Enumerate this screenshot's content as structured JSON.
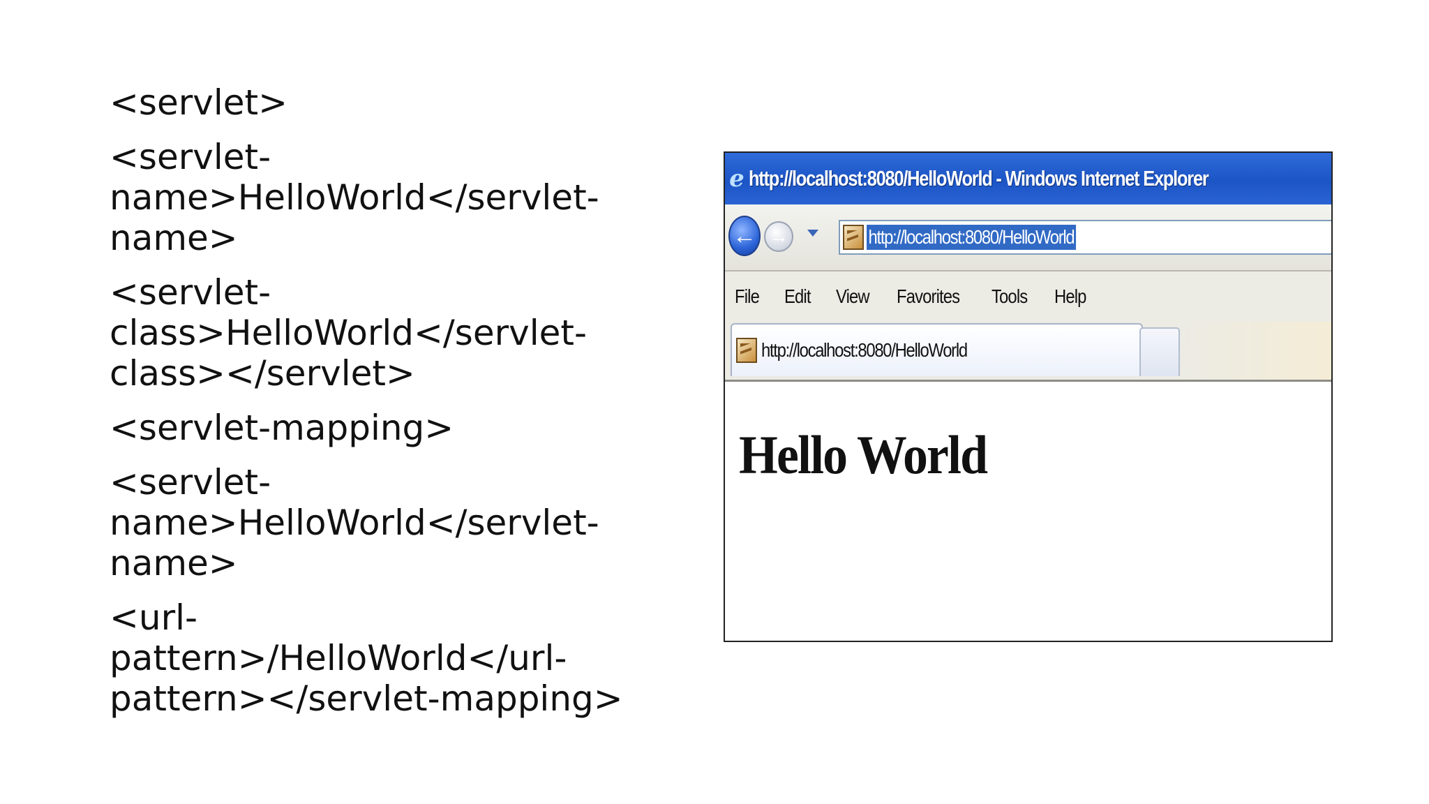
{
  "code_lines": [
    "<servlet>",
    "<servlet-\nname>HelloWorld</servlet-\nname>",
    "<servlet-\nclass>HelloWorld</servlet-\nclass></servlet>",
    "<servlet-mapping>",
    "<servlet-\nname>HelloWorld</servlet-\nname>",
    "<url-pattern>/HelloWorld</url-\npattern></servlet-mapping>"
  ],
  "browser": {
    "window_title": "http://localhost:8080/HelloWorld - Windows Internet Explorer",
    "app_icon": "ie-logo-icon",
    "back_icon": "back-arrow-icon",
    "forward_icon": "forward-arrow-icon",
    "address_url": "http://localhost:8080/HelloWorld",
    "menu": [
      "File",
      "Edit",
      "View",
      "Favorites",
      "Tools",
      "Help"
    ],
    "tab_title": "http://localhost:8080/HelloWorld",
    "page_heading": "Hello World"
  }
}
